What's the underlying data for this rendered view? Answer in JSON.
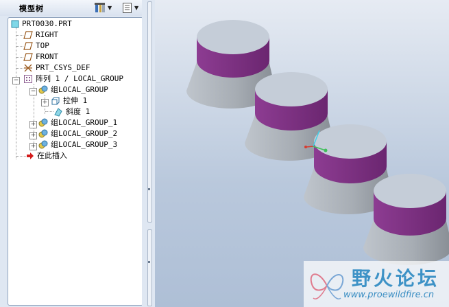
{
  "model_tree": {
    "title": "模型树",
    "toolbar": {
      "settings_icon": "tools-icon",
      "columns_icon": "list-settings-icon"
    },
    "items": [
      {
        "label": "PRT0030.PRT",
        "icon": "part-icon"
      },
      {
        "label": "RIGHT",
        "icon": "datum-plane-icon"
      },
      {
        "label": "TOP",
        "icon": "datum-plane-icon"
      },
      {
        "label": "FRONT",
        "icon": "datum-plane-icon"
      },
      {
        "label": "PRT_CSYS_DEF",
        "icon": "csys-icon"
      },
      {
        "label": "阵列 1 / LOCAL_GROUP",
        "icon": "pattern-icon"
      },
      {
        "label": "组LOCAL_GROUP",
        "icon": "group-icon"
      },
      {
        "label": "拉伸 1",
        "icon": "extrude-icon"
      },
      {
        "label": "斜度 1",
        "icon": "draft-icon"
      },
      {
        "label": "组LOCAL_GROUP_1",
        "icon": "group-icon"
      },
      {
        "label": "组LOCAL_GROUP_2",
        "icon": "group-icon"
      },
      {
        "label": "组LOCAL_GROUP_3",
        "icon": "group-icon"
      },
      {
        "label": "在此插入",
        "icon": "insert-here-icon"
      }
    ]
  },
  "watermark": {
    "title": "野火论坛",
    "url": "www.proewildfire.cn"
  },
  "colors": {
    "top_face": "#c5cdd8",
    "draft_band": "#7a2f7e",
    "lower_body": "#a8aeb5"
  }
}
